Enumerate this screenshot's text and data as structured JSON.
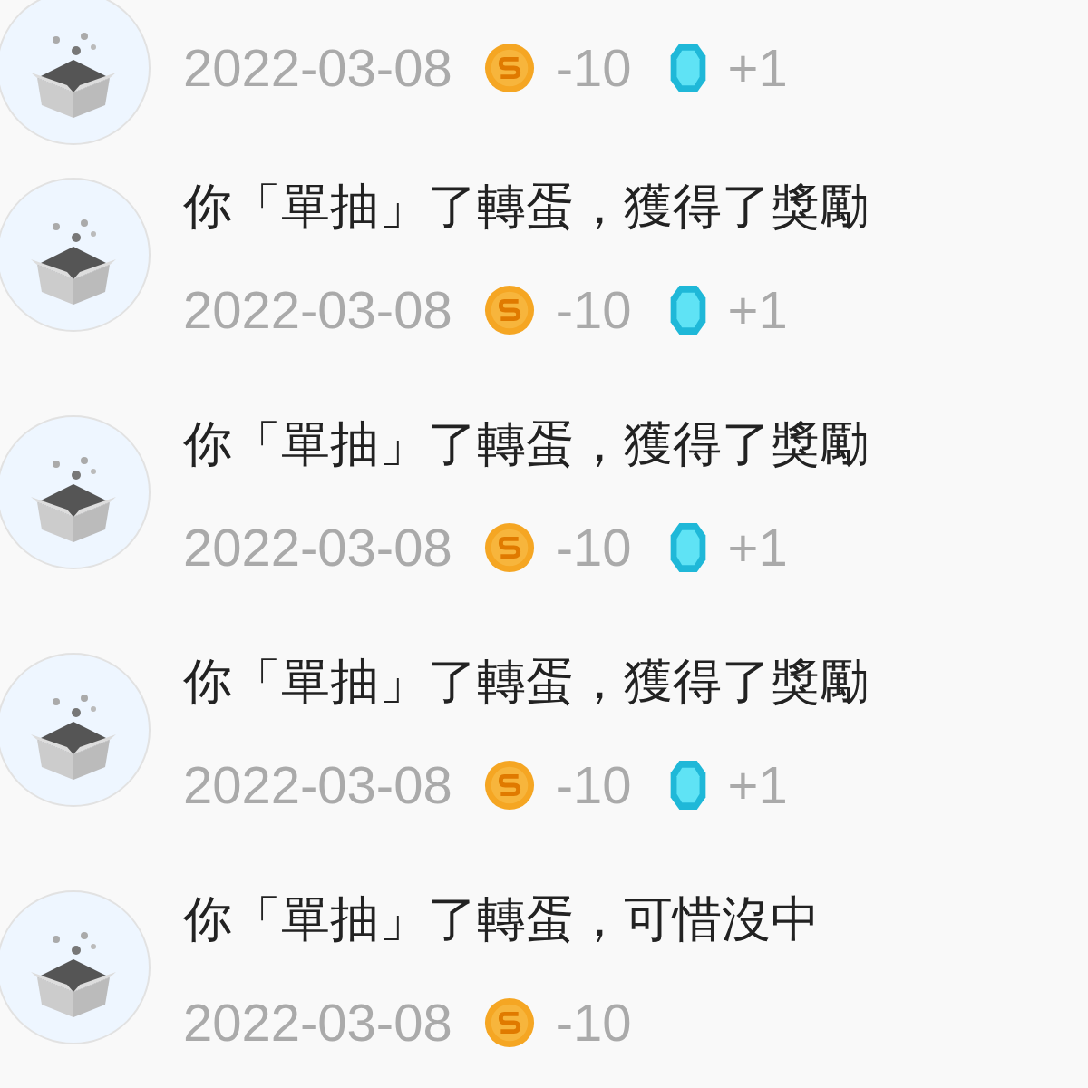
{
  "records": [
    {
      "date": "2022-03-08",
      "rewards": [
        {
          "kind": "coin",
          "amount": "-10"
        },
        {
          "kind": "gem",
          "amount": "+1"
        }
      ]
    },
    {
      "title": "你「單抽」了轉蛋，獲得了獎勵",
      "date": "2022-03-08",
      "rewards": [
        {
          "kind": "coin",
          "amount": "-10"
        },
        {
          "kind": "gem",
          "amount": "+1"
        }
      ]
    },
    {
      "title": "你「單抽」了轉蛋，獲得了獎勵",
      "date": "2022-03-08",
      "rewards": [
        {
          "kind": "coin",
          "amount": "-10"
        },
        {
          "kind": "gem",
          "amount": "+1"
        }
      ]
    },
    {
      "title": "你「單抽」了轉蛋，獲得了獎勵",
      "date": "2022-03-08",
      "rewards": [
        {
          "kind": "coin",
          "amount": "-10"
        },
        {
          "kind": "gem",
          "amount": "+1"
        }
      ]
    },
    {
      "title": "你「單抽」了轉蛋，可惜沒中",
      "date": "2022-03-08",
      "rewards": [
        {
          "kind": "coin",
          "amount": "-10"
        }
      ]
    }
  ]
}
